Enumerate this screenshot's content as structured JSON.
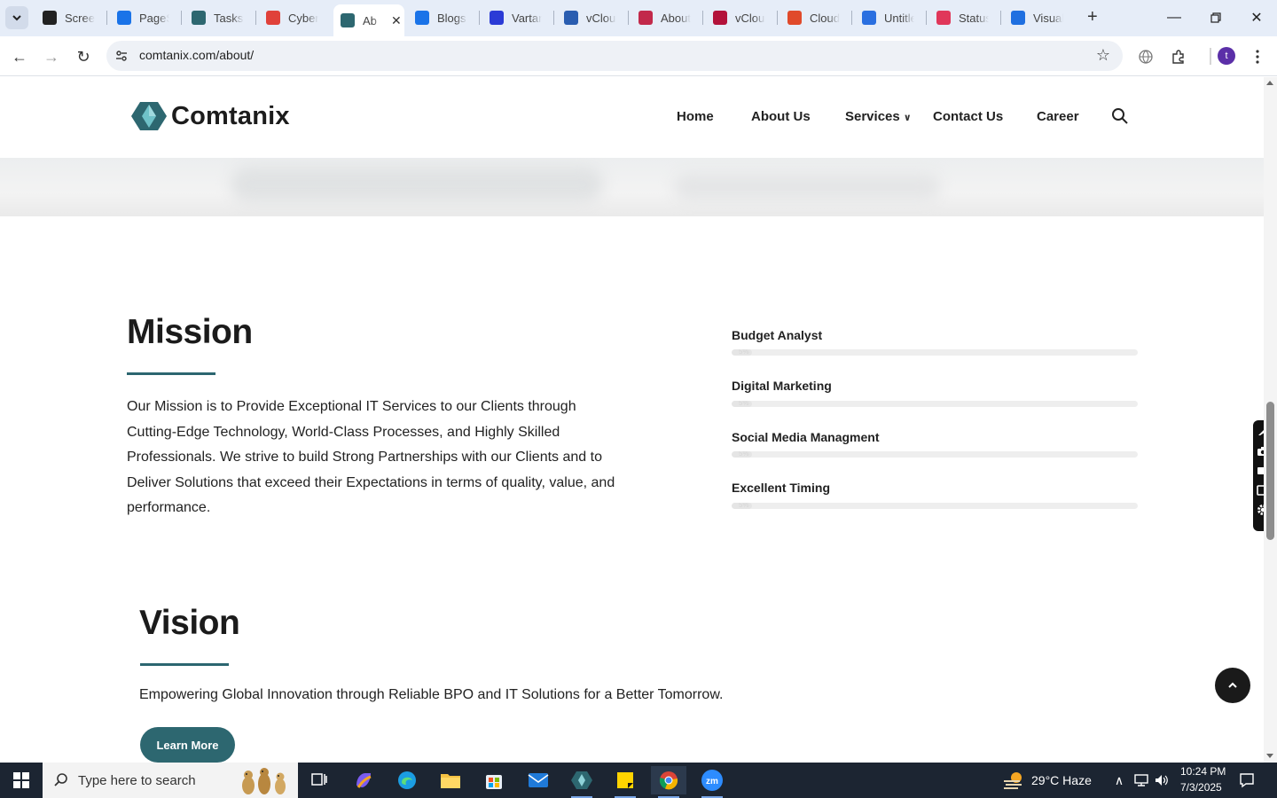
{
  "browser": {
    "tabs": [
      {
        "label": "Screen",
        "icon": "screencast-icon",
        "color": "#222222"
      },
      {
        "label": "PageSp",
        "icon": "pagespeed-icon",
        "color": "#1a73e8"
      },
      {
        "label": "Tasks",
        "icon": "tasks-icon",
        "color": "#2d6770"
      },
      {
        "label": "Cybers",
        "icon": "cybersecurity-icon",
        "color": "#e0413a"
      },
      {
        "label": "Ab",
        "icon": "comtanix-icon",
        "color": "#2d6770"
      },
      {
        "label": "Blogs -",
        "icon": "blogs-icon",
        "color": "#1a73e8"
      },
      {
        "label": "Vartan",
        "icon": "vartana-icon",
        "color": "#2b3bd6"
      },
      {
        "label": "vCloud",
        "icon": "vcloud-icon",
        "color": "#2a5db0"
      },
      {
        "label": "About",
        "icon": "about-icon",
        "color": "#c2294b"
      },
      {
        "label": "vCloud",
        "icon": "vcloud-v-icon",
        "color": "#b3123a"
      },
      {
        "label": "Cloud",
        "icon": "cloud-icon",
        "color": "#e04a2b"
      },
      {
        "label": "Untitle",
        "icon": "docs-icon",
        "color": "#2a6fe0"
      },
      {
        "label": "StatusC",
        "icon": "status-icon",
        "color": "#e0375a"
      },
      {
        "label": "Visualp",
        "icon": "visualping-icon",
        "color": "#1f6fe0"
      }
    ],
    "active_tab_index": 4,
    "url": "comtanix.com/about/",
    "profile_initial": "t"
  },
  "site": {
    "logo_text": "Comtanix",
    "brand_color": "#2d6770",
    "nav": [
      {
        "label": "Home"
      },
      {
        "label": "About Us"
      },
      {
        "label": "Services",
        "has_dropdown": true
      },
      {
        "label": "Contact Us"
      },
      {
        "label": "Career"
      }
    ]
  },
  "mission": {
    "title": "Mission",
    "text": "Our Mission is to Provide Exceptional  IT Services to our Clients through Cutting-Edge Technology, World-Class Processes, and Highly Skilled Professionals. We strive to build Strong Partnerships with our Clients and to Deliver Solutions that exceed their Expectations in terms of quality, value, and performance."
  },
  "skills": [
    {
      "label": "Budget Analyst",
      "percent": 5,
      "pct_text": "5%"
    },
    {
      "label": "Digital Marketing",
      "percent": 5,
      "pct_text": "5%"
    },
    {
      "label": "Social Media Managment",
      "percent": 5,
      "pct_text": "5%"
    },
    {
      "label": "Excellent Timing",
      "percent": 5,
      "pct_text": "5%"
    }
  ],
  "vision": {
    "title": "Vision",
    "text": "Empowering Global Innovation through Reliable BPO and IT Solutions for a Better Tomorrow.",
    "button_label": "Learn More"
  },
  "taskbar": {
    "search_placeholder": "Type here to search",
    "weather": "29°C  Haze",
    "time": "10:24 PM",
    "date": "7/3/2025"
  }
}
